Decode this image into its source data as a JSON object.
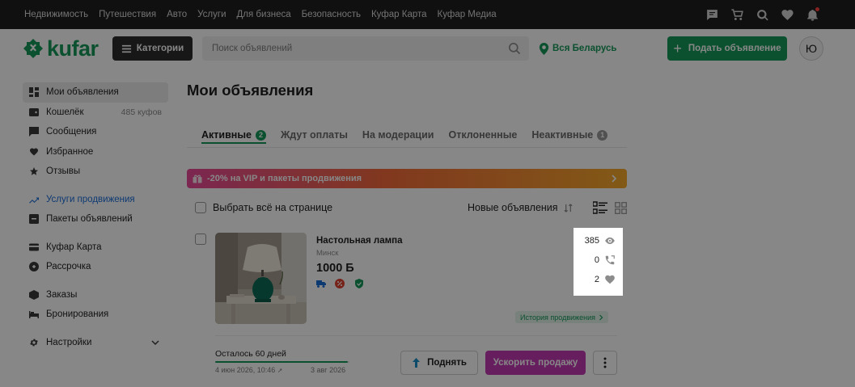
{
  "topnav": [
    "Недвижимость",
    "Путешествия",
    "Авто",
    "Услуги",
    "Для бизнеса",
    "Безопасность",
    "Куфар Карта",
    "Куфар Медиа"
  ],
  "topicons": [
    "chat-icon",
    "cart-icon",
    "search-chat-icon",
    "heart-icon",
    "bell-icon"
  ],
  "logo": "kufar",
  "categories_label": "Категории",
  "search_placeholder": "Поиск объявлений",
  "location": "Вся Беларусь",
  "post_label": "Подать объявление",
  "avatar_letter": "Ю",
  "sidebar": [
    {
      "label": "Мои объявления",
      "icon": "dashboard-icon",
      "extra": ""
    },
    {
      "label": "Кошелёк",
      "icon": "wallet-icon",
      "extra": "485 куфов"
    },
    {
      "label": "Сообщения",
      "icon": "chat-icon",
      "extra": ""
    },
    {
      "label": "Избранное",
      "icon": "heart-icon",
      "extra": ""
    },
    {
      "label": "Отзывы",
      "icon": "star-icon",
      "extra": ""
    },
    {
      "label": "Услуги продвижения",
      "icon": "trend-up-icon",
      "extra": ""
    },
    {
      "label": "Пакеты объявлений",
      "icon": "package-icon",
      "extra": ""
    },
    {
      "label": "Куфар Карта",
      "icon": "card-icon",
      "extra": ""
    },
    {
      "label": "Рассрочка",
      "icon": "installment-icon",
      "extra": ""
    },
    {
      "label": "Заказы",
      "icon": "box-icon",
      "extra": ""
    },
    {
      "label": "Бронирования",
      "icon": "bed-icon",
      "extra": ""
    },
    {
      "label": "Настройки",
      "icon": "gear-icon",
      "extra": ""
    }
  ],
  "page_title": "Мои объявления",
  "tabs": [
    {
      "label": "Активные",
      "badge": "2"
    },
    {
      "label": "Ждут оплаты",
      "badge": ""
    },
    {
      "label": "На модерации",
      "badge": ""
    },
    {
      "label": "Отклоненные",
      "badge": ""
    },
    {
      "label": "Неактивные",
      "badge": "1"
    }
  ],
  "promo_banner": "-20% на VIP и пакеты продвижения",
  "select_all": "Выбрать всё на странице",
  "sort_label": "Новые объявления",
  "listing": {
    "title": "Настольная лампа",
    "city": "Минск",
    "price": "1000 Б",
    "views": "385",
    "calls": "0",
    "favorites": "2",
    "promo_history": "История продвижения",
    "days_left": "Осталось 60 дней",
    "date_start": "4 июн 2026, 10:46",
    "date_end": "3 авг 2026",
    "progress": 0.99,
    "raise_label": "Поднять",
    "boost_label": "Ускорить продажу"
  },
  "colors": {
    "brand": "#169a5a",
    "boost": "#c239b3",
    "link": "#1a6dd8"
  }
}
